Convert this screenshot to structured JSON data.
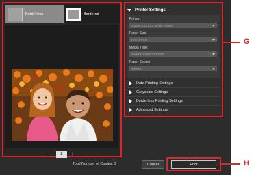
{
  "layouts": {
    "borderless_label": "Borderless",
    "bordered_label": "Bordered",
    "selected": "Borderless"
  },
  "preview": {
    "photo_description": "two smiling children in front of orange flowers"
  },
  "pager": {
    "prev": "−",
    "page": "1",
    "next": "+"
  },
  "printer_settings": {
    "title": "Printer Settings",
    "fields": [
      {
        "label": "Printer:",
        "value": "Canon XXXXXX series Printer"
      },
      {
        "label": "Paper Size:",
        "value": "XXXXX XX"
      },
      {
        "label": "Media Type:",
        "value": "XXXXX XXXX XXXXXX"
      },
      {
        "label": "Paper Source:",
        "value": "XXXXX"
      }
    ],
    "collapsed_sections": [
      "Date Printing Settings",
      "Grayscale Settings",
      "Borderless Printing Settings",
      "Advanced Settings"
    ]
  },
  "footer": {
    "total_copies": "Total Number of Copies: 1",
    "cancel_label": "Cancel",
    "print_label": "Print"
  },
  "callouts": {
    "g": "G",
    "h": "H"
  },
  "colors": {
    "highlight": "#e0242c",
    "panel_bg": "#2c2c2c"
  }
}
